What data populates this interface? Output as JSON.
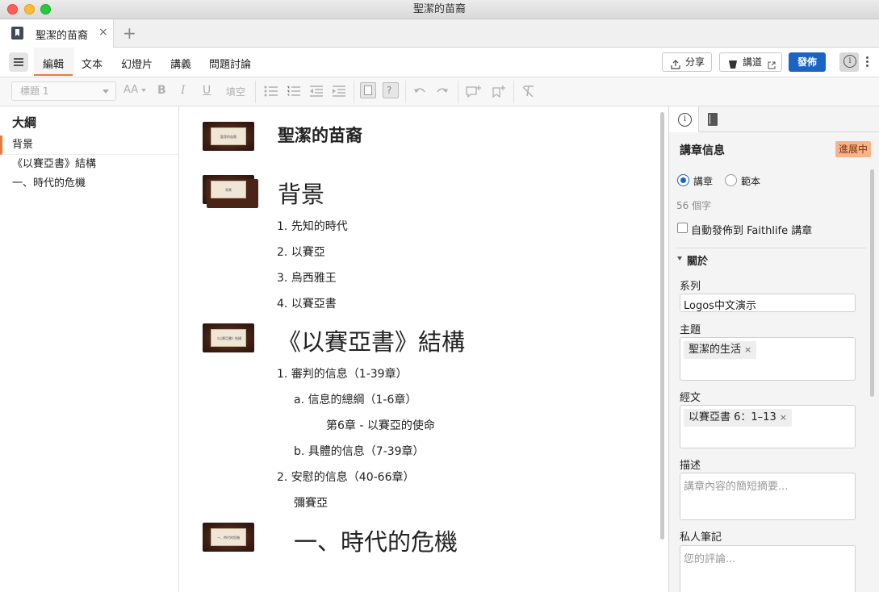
{
  "window": {
    "title": "聖潔的苗裔"
  },
  "tabs": {
    "doc_label": "聖潔的苗裔",
    "close": "×",
    "new": "+"
  },
  "menu": {
    "tabs": [
      "編輯",
      "文本",
      "幻燈片",
      "講義",
      "問題討論"
    ],
    "share_label": "分享",
    "preach_label": "講道",
    "publish_label": "發佈"
  },
  "toolbar": {
    "style_value": "標題 1",
    "font_size": "AA",
    "bold": "B",
    "italic": "I",
    "underline": "U",
    "fill_blank": "填空"
  },
  "outline": {
    "title": "大綱",
    "items": [
      "背景",
      "《以賽亞書》結構",
      "一、時代的危機"
    ]
  },
  "editor": {
    "doc_title": "聖潔的苗裔",
    "thumb_labels": [
      "聖潔的苗裔",
      "背景",
      "《以賽亞書》結構",
      "一、時代的危機"
    ],
    "section1": {
      "heading": "背景",
      "items": [
        "1.  先知的時代",
        "2.  以賽亞",
        "3.  烏西雅王",
        "4.  以賽亞書"
      ]
    },
    "section2": {
      "heading": "《以賽亞書》結構",
      "l1": "1.  審判的信息（1-39章）",
      "l1a": "a.  信息的總綱（1-6章）",
      "l1a_note": "第6章 - 以賽亞的使命",
      "l1b": "b.  具體的信息（7-39章）",
      "l2": "2.  安慰的信息（40-66章）",
      "l2_note": "彌賽亞"
    },
    "section3": {
      "heading": "一、時代的危機"
    }
  },
  "panel": {
    "heading": "講章信息",
    "badge": "進展中",
    "radio_sermon": "講章",
    "radio_template": "範本",
    "word_count": "56 個字",
    "auto_publish": "自動發佈到 Faithlife 講章",
    "about": "關於",
    "series_label": "系列",
    "series_value": "Logos中文演示",
    "topic_label": "主題",
    "topic_tag": "聖潔的生活",
    "scripture_label": "經文",
    "scripture_tag": "以賽亞書 6：1–13",
    "desc_label": "描述",
    "desc_placeholder": "講章內容的簡短摘要...",
    "notes_label": "私人筆記",
    "notes_placeholder": "您的評論..."
  },
  "icons": [
    "hamburger-icon",
    "share-icon",
    "preach-icon",
    "external-link-icon",
    "info-icon",
    "more-icon",
    "book-icon"
  ]
}
